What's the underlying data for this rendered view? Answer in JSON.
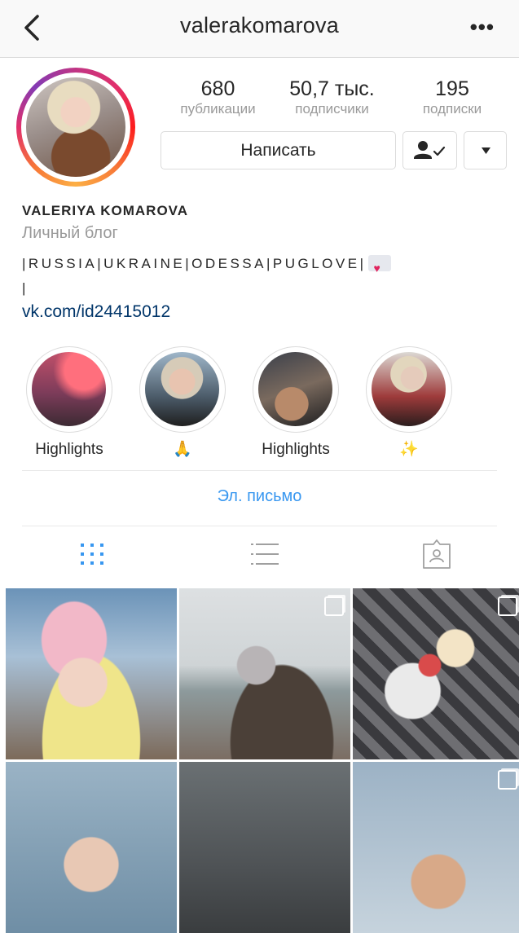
{
  "header": {
    "title": "valerakomarova",
    "back_icon": "chevron-left-icon",
    "more_label": "•••"
  },
  "profile": {
    "stats": [
      {
        "value": "680",
        "label": "публикации"
      },
      {
        "value": "50,7 тыс.",
        "label": "подписчики"
      },
      {
        "value": "195",
        "label": "подписки"
      }
    ],
    "message_button": "Написать",
    "name": "VALERIYA KOMAROVA",
    "category": "Личный блог",
    "bio": "|RUSSIA|UKRAINE|ODESSA|PUGLOVE|",
    "bio_line2": "|",
    "link": "vk.com/id24415012"
  },
  "highlights": [
    {
      "label": "Highlights"
    },
    {
      "label": "🙏"
    },
    {
      "label": "Highlights"
    },
    {
      "label": "✨"
    }
  ],
  "contact": {
    "email_label": "Эл. письмо"
  },
  "colors": {
    "accent": "#3897f0",
    "link": "#003569",
    "muted": "#999999"
  }
}
